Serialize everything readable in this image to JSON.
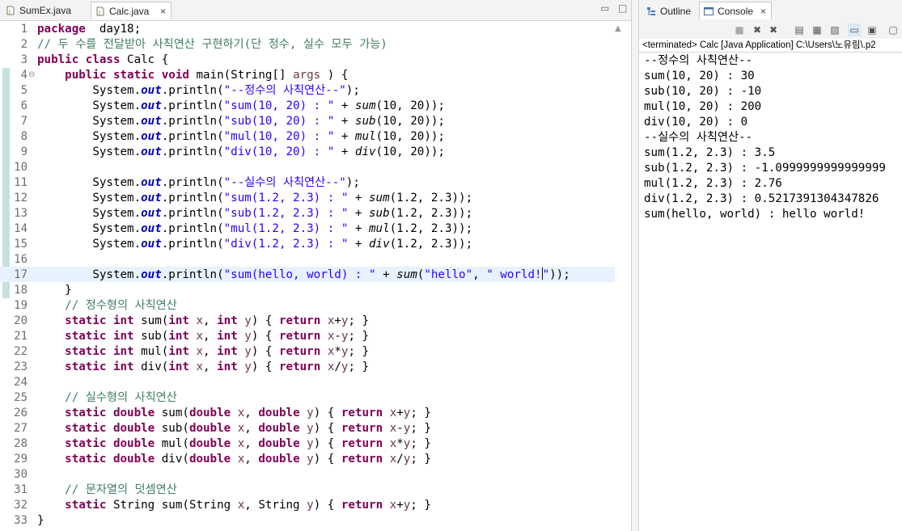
{
  "editor": {
    "tabs": [
      {
        "label": "SumEx.java",
        "active": false
      },
      {
        "label": "Calc.java",
        "active": true
      }
    ],
    "minimize_glyph": "▭",
    "maximize_glyph": "□",
    "close_glyph": "×",
    "scroll_up_glyph": "▲",
    "fold_glyph": "⊖",
    "current_line": 17,
    "lines": [
      {
        "n": "1",
        "tokens": [
          [
            "kw",
            "package"
          ],
          [
            "",
            "  day18;"
          ]
        ]
      },
      {
        "n": "2",
        "tokens": [
          [
            "cm",
            "// 두 수를 전달받아 사칙연산 구현하기(단 정수, 실수 모두 가능)"
          ]
        ]
      },
      {
        "n": "3",
        "tokens": [
          [
            "kw",
            "public"
          ],
          [
            "",
            " "
          ],
          [
            "kw",
            "class"
          ],
          [
            "",
            " Calc {"
          ]
        ]
      },
      {
        "n": "4",
        "fold": true,
        "tokens": [
          [
            "",
            "    "
          ],
          [
            "kw",
            "public"
          ],
          [
            "",
            " "
          ],
          [
            "kw",
            "static"
          ],
          [
            "",
            " "
          ],
          [
            "kw",
            "void"
          ],
          [
            "",
            " main(String[] "
          ],
          [
            "va",
            "args"
          ],
          [
            "",
            " ) {"
          ]
        ]
      },
      {
        "n": "5",
        "tokens": [
          [
            "",
            "        System."
          ],
          [
            "fi",
            "out"
          ],
          [
            "",
            ".println("
          ],
          [
            "st",
            "\"--정수의 사칙연산--\""
          ],
          [
            "",
            ");"
          ]
        ]
      },
      {
        "n": "6",
        "tokens": [
          [
            "",
            "        System."
          ],
          [
            "fi",
            "out"
          ],
          [
            "",
            ".println("
          ],
          [
            "st",
            "\"sum(10, 20) : \""
          ],
          [
            "",
            " + "
          ],
          [
            "mi",
            "sum"
          ],
          [
            "",
            "(10, 20));"
          ]
        ]
      },
      {
        "n": "7",
        "tokens": [
          [
            "",
            "        System."
          ],
          [
            "fi",
            "out"
          ],
          [
            "",
            ".println("
          ],
          [
            "st",
            "\"sub(10, 20) : \""
          ],
          [
            "",
            " + "
          ],
          [
            "mi",
            "sub"
          ],
          [
            "",
            "(10, 20));"
          ]
        ]
      },
      {
        "n": "8",
        "tokens": [
          [
            "",
            "        System."
          ],
          [
            "fi",
            "out"
          ],
          [
            "",
            ".println("
          ],
          [
            "st",
            "\"mul(10, 20) : \""
          ],
          [
            "",
            " + "
          ],
          [
            "mi",
            "mul"
          ],
          [
            "",
            "(10, 20));"
          ]
        ]
      },
      {
        "n": "9",
        "tokens": [
          [
            "",
            "        System."
          ],
          [
            "fi",
            "out"
          ],
          [
            "",
            ".println("
          ],
          [
            "st",
            "\"div(10, 20) : \""
          ],
          [
            "",
            " + "
          ],
          [
            "mi",
            "div"
          ],
          [
            "",
            "(10, 20));"
          ]
        ]
      },
      {
        "n": "10",
        "tokens": []
      },
      {
        "n": "11",
        "tokens": [
          [
            "",
            "        System."
          ],
          [
            "fi",
            "out"
          ],
          [
            "",
            ".println("
          ],
          [
            "st",
            "\"--실수의 사칙연산--\""
          ],
          [
            "",
            ");"
          ]
        ]
      },
      {
        "n": "12",
        "tokens": [
          [
            "",
            "        System."
          ],
          [
            "fi",
            "out"
          ],
          [
            "",
            ".println("
          ],
          [
            "st",
            "\"sum(1.2, 2.3) : \""
          ],
          [
            "",
            " + "
          ],
          [
            "mi",
            "sum"
          ],
          [
            "",
            "(1.2, 2.3));"
          ]
        ]
      },
      {
        "n": "13",
        "tokens": [
          [
            "",
            "        System."
          ],
          [
            "fi",
            "out"
          ],
          [
            "",
            ".println("
          ],
          [
            "st",
            "\"sub(1.2, 2.3) : \""
          ],
          [
            "",
            " + "
          ],
          [
            "mi",
            "sub"
          ],
          [
            "",
            "(1.2, 2.3));"
          ]
        ]
      },
      {
        "n": "14",
        "tokens": [
          [
            "",
            "        System."
          ],
          [
            "fi",
            "out"
          ],
          [
            "",
            ".println("
          ],
          [
            "st",
            "\"mul(1.2, 2.3) : \""
          ],
          [
            "",
            " + "
          ],
          [
            "mi",
            "mul"
          ],
          [
            "",
            "(1.2, 2.3));"
          ]
        ]
      },
      {
        "n": "15",
        "tokens": [
          [
            "",
            "        System."
          ],
          [
            "fi",
            "out"
          ],
          [
            "",
            ".println("
          ],
          [
            "st",
            "\"div(1.2, 2.3) : \""
          ],
          [
            "",
            " + "
          ],
          [
            "mi",
            "div"
          ],
          [
            "",
            "(1.2, 2.3));"
          ]
        ]
      },
      {
        "n": "16",
        "tokens": []
      },
      {
        "n": "17",
        "tokens": [
          [
            "",
            "        System."
          ],
          [
            "fi",
            "out"
          ],
          [
            "",
            ".println("
          ],
          [
            "st",
            "\"sum(hello, world) : \""
          ],
          [
            "",
            " + "
          ],
          [
            "mi",
            "sum"
          ],
          [
            "",
            "("
          ],
          [
            "st",
            "\"hello\""
          ],
          [
            "",
            ", "
          ],
          [
            "st",
            "\" world!"
          ],
          [
            "caret",
            ""
          ],
          [
            "st",
            "\""
          ],
          [
            "",
            "));"
          ]
        ]
      },
      {
        "n": "18",
        "tokens": [
          [
            "",
            "    }"
          ]
        ]
      },
      {
        "n": "19",
        "tokens": [
          [
            "",
            "    "
          ],
          [
            "cm",
            "// 정수형의 사칙연산"
          ]
        ]
      },
      {
        "n": "20",
        "tokens": [
          [
            "",
            "    "
          ],
          [
            "kw",
            "static"
          ],
          [
            "",
            " "
          ],
          [
            "kw",
            "int"
          ],
          [
            "",
            " sum("
          ],
          [
            "kw",
            "int"
          ],
          [
            "",
            " "
          ],
          [
            "va",
            "x"
          ],
          [
            "",
            ", "
          ],
          [
            "kw",
            "int"
          ],
          [
            "",
            " "
          ],
          [
            "va",
            "y"
          ],
          [
            "",
            ") { "
          ],
          [
            "kw",
            "return"
          ],
          [
            "",
            " "
          ],
          [
            "va",
            "x"
          ],
          [
            "",
            "+"
          ],
          [
            "va",
            "y"
          ],
          [
            "",
            "; }"
          ]
        ]
      },
      {
        "n": "21",
        "tokens": [
          [
            "",
            "    "
          ],
          [
            "kw",
            "static"
          ],
          [
            "",
            " "
          ],
          [
            "kw",
            "int"
          ],
          [
            "",
            " sub("
          ],
          [
            "kw",
            "int"
          ],
          [
            "",
            " "
          ],
          [
            "va",
            "x"
          ],
          [
            "",
            ", "
          ],
          [
            "kw",
            "int"
          ],
          [
            "",
            " "
          ],
          [
            "va",
            "y"
          ],
          [
            "",
            ") { "
          ],
          [
            "kw",
            "return"
          ],
          [
            "",
            " "
          ],
          [
            "va",
            "x"
          ],
          [
            "",
            "-"
          ],
          [
            "va",
            "y"
          ],
          [
            "",
            "; }"
          ]
        ]
      },
      {
        "n": "22",
        "tokens": [
          [
            "",
            "    "
          ],
          [
            "kw",
            "static"
          ],
          [
            "",
            " "
          ],
          [
            "kw",
            "int"
          ],
          [
            "",
            " mul("
          ],
          [
            "kw",
            "int"
          ],
          [
            "",
            " "
          ],
          [
            "va",
            "x"
          ],
          [
            "",
            ", "
          ],
          [
            "kw",
            "int"
          ],
          [
            "",
            " "
          ],
          [
            "va",
            "y"
          ],
          [
            "",
            ") { "
          ],
          [
            "kw",
            "return"
          ],
          [
            "",
            " "
          ],
          [
            "va",
            "x"
          ],
          [
            "",
            "*"
          ],
          [
            "va",
            "y"
          ],
          [
            "",
            "; }"
          ]
        ]
      },
      {
        "n": "23",
        "tokens": [
          [
            "",
            "    "
          ],
          [
            "kw",
            "static"
          ],
          [
            "",
            " "
          ],
          [
            "kw",
            "int"
          ],
          [
            "",
            " div("
          ],
          [
            "kw",
            "int"
          ],
          [
            "",
            " "
          ],
          [
            "va",
            "x"
          ],
          [
            "",
            ", "
          ],
          [
            "kw",
            "int"
          ],
          [
            "",
            " "
          ],
          [
            "va",
            "y"
          ],
          [
            "",
            ") { "
          ],
          [
            "kw",
            "return"
          ],
          [
            "",
            " "
          ],
          [
            "va",
            "x"
          ],
          [
            "",
            "/"
          ],
          [
            "va",
            "y"
          ],
          [
            "",
            "; }"
          ]
        ]
      },
      {
        "n": "24",
        "tokens": []
      },
      {
        "n": "25",
        "tokens": [
          [
            "",
            "    "
          ],
          [
            "cm",
            "// 실수형의 사칙연산"
          ]
        ]
      },
      {
        "n": "26",
        "tokens": [
          [
            "",
            "    "
          ],
          [
            "kw",
            "static"
          ],
          [
            "",
            " "
          ],
          [
            "kw",
            "double"
          ],
          [
            "",
            " sum("
          ],
          [
            "kw",
            "double"
          ],
          [
            "",
            " "
          ],
          [
            "va",
            "x"
          ],
          [
            "",
            ", "
          ],
          [
            "kw",
            "double"
          ],
          [
            "",
            " "
          ],
          [
            "va",
            "y"
          ],
          [
            "",
            ") { "
          ],
          [
            "kw",
            "return"
          ],
          [
            "",
            " "
          ],
          [
            "va",
            "x"
          ],
          [
            "",
            "+"
          ],
          [
            "va",
            "y"
          ],
          [
            "",
            "; }"
          ]
        ]
      },
      {
        "n": "27",
        "tokens": [
          [
            "",
            "    "
          ],
          [
            "kw",
            "static"
          ],
          [
            "",
            " "
          ],
          [
            "kw",
            "double"
          ],
          [
            "",
            " sub("
          ],
          [
            "kw",
            "double"
          ],
          [
            "",
            " "
          ],
          [
            "va",
            "x"
          ],
          [
            "",
            ", "
          ],
          [
            "kw",
            "double"
          ],
          [
            "",
            " "
          ],
          [
            "va",
            "y"
          ],
          [
            "",
            ") { "
          ],
          [
            "kw",
            "return"
          ],
          [
            "",
            " "
          ],
          [
            "va",
            "x"
          ],
          [
            "",
            "-"
          ],
          [
            "va",
            "y"
          ],
          [
            "",
            "; }"
          ]
        ]
      },
      {
        "n": "28",
        "tokens": [
          [
            "",
            "    "
          ],
          [
            "kw",
            "static"
          ],
          [
            "",
            " "
          ],
          [
            "kw",
            "double"
          ],
          [
            "",
            " mul("
          ],
          [
            "kw",
            "double"
          ],
          [
            "",
            " "
          ],
          [
            "va",
            "x"
          ],
          [
            "",
            ", "
          ],
          [
            "kw",
            "double"
          ],
          [
            "",
            " "
          ],
          [
            "va",
            "y"
          ],
          [
            "",
            ") { "
          ],
          [
            "kw",
            "return"
          ],
          [
            "",
            " "
          ],
          [
            "va",
            "x"
          ],
          [
            "",
            "*"
          ],
          [
            "va",
            "y"
          ],
          [
            "",
            "; }"
          ]
        ]
      },
      {
        "n": "29",
        "tokens": [
          [
            "",
            "    "
          ],
          [
            "kw",
            "static"
          ],
          [
            "",
            " "
          ],
          [
            "kw",
            "double"
          ],
          [
            "",
            " div("
          ],
          [
            "kw",
            "double"
          ],
          [
            "",
            " "
          ],
          [
            "va",
            "x"
          ],
          [
            "",
            ", "
          ],
          [
            "kw",
            "double"
          ],
          [
            "",
            " "
          ],
          [
            "va",
            "y"
          ],
          [
            "",
            ") { "
          ],
          [
            "kw",
            "return"
          ],
          [
            "",
            " "
          ],
          [
            "va",
            "x"
          ],
          [
            "",
            "/"
          ],
          [
            "va",
            "y"
          ],
          [
            "",
            "; }"
          ]
        ]
      },
      {
        "n": "30",
        "tokens": []
      },
      {
        "n": "31",
        "tokens": [
          [
            "",
            "    "
          ],
          [
            "cm",
            "// 문자열의 덧셈연산"
          ]
        ]
      },
      {
        "n": "32",
        "tokens": [
          [
            "",
            "    "
          ],
          [
            "kw",
            "static"
          ],
          [
            "",
            " String sum(String "
          ],
          [
            "va",
            "x"
          ],
          [
            "",
            ", String "
          ],
          [
            "va",
            "y"
          ],
          [
            "",
            ") { "
          ],
          [
            "kw",
            "return"
          ],
          [
            "",
            " "
          ],
          [
            "va",
            "x"
          ],
          [
            "",
            "+"
          ],
          [
            "va",
            "y"
          ],
          [
            "",
            "; }"
          ]
        ]
      },
      {
        "n": "33",
        "tokens": [
          [
            "",
            "}"
          ]
        ]
      }
    ]
  },
  "console": {
    "tabs": [
      {
        "label": "Outline",
        "icon": "outline-icon"
      },
      {
        "label": "Console",
        "icon": "console-icon"
      }
    ],
    "close_glyph": "×",
    "status": "<terminated> Calc [Java Application] C:\\Users\\노유림\\.p2",
    "output": [
      "--정수의 사칙연산--",
      "sum(10, 20) : 30",
      "sub(10, 20) : -10",
      "mul(10, 20) : 200",
      "div(10, 20) : 0",
      "--실수의 사칙연산--",
      "sum(1.2, 2.3) : 3.5",
      "sub(1.2, 2.3) : -1.0999999999999999",
      "mul(1.2, 2.3) : 2.76",
      "div(1.2, 2.3) : 0.5217391304347826",
      "sum(hello, world) : hello world!"
    ]
  },
  "colors": {
    "keyword": "#7f0055",
    "comment": "#3f7f5f",
    "string": "#2a00ff",
    "field": "#0000c0",
    "current_line_bg": "#e8f2fe",
    "change_bar": "#c6e1e0"
  }
}
